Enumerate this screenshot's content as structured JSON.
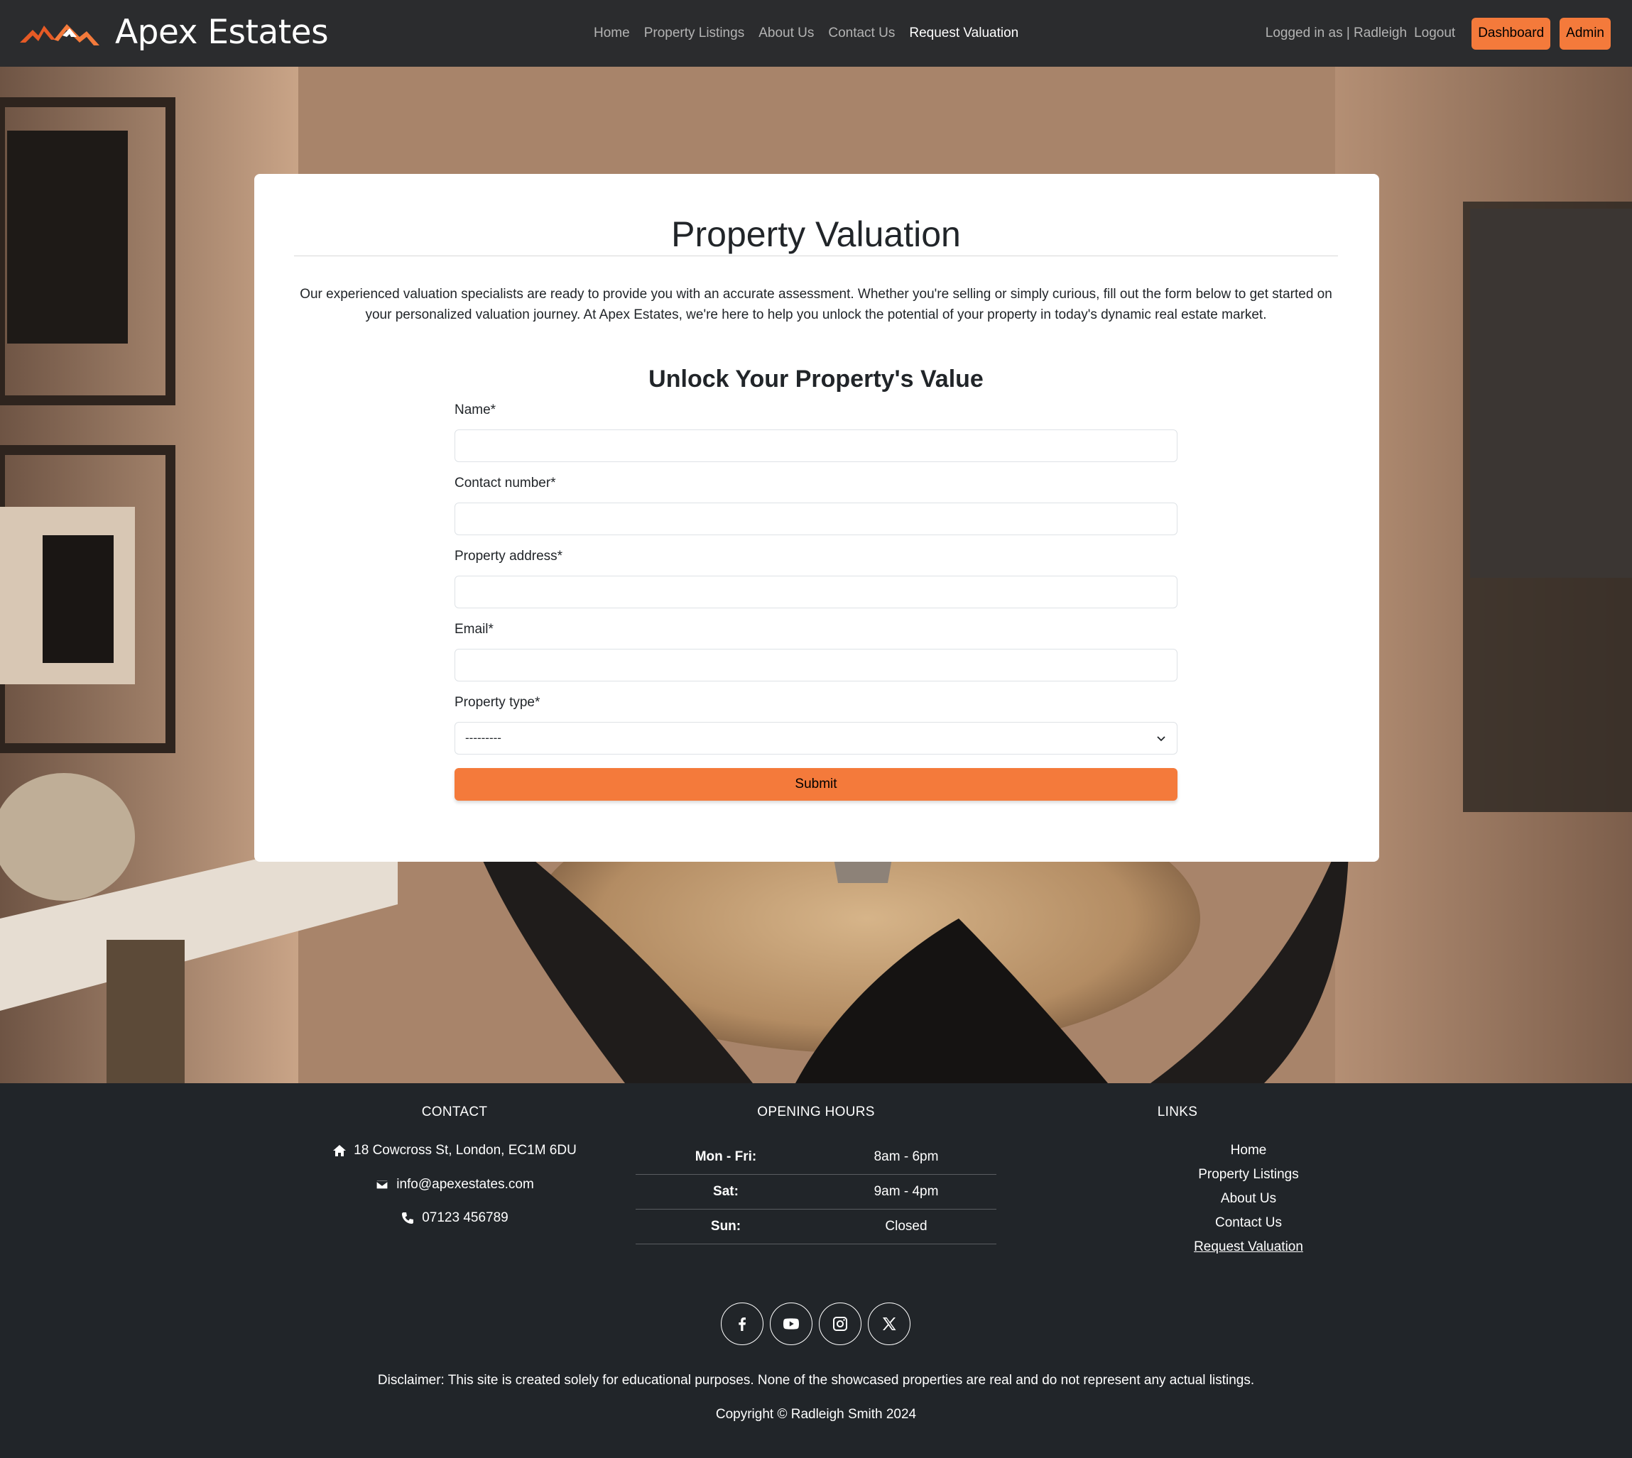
{
  "brand": {
    "name": "Apex Estates",
    "logo_icon": "mountain-logo"
  },
  "nav": {
    "links": [
      "Home",
      "Property Listings",
      "About Us",
      "Contact Us",
      "Request Valuation"
    ],
    "active": "Request Valuation",
    "logged_in_text": "Logged in as | Radleigh",
    "logout_label": "Logout",
    "dashboard_label": "Dashboard",
    "admin_label": "Admin"
  },
  "card": {
    "title": "Property Valuation",
    "intro": "Our experienced valuation specialists are ready to provide you with an accurate assessment. Whether you're selling or simply curious, fill out the form below to get started on your personalized valuation journey. At Apex Estates, we're here to help you unlock the potential of your property in today's dynamic real estate market.",
    "form_title": "Unlock Your Property's Value",
    "fields": {
      "name_label": "Name*",
      "name_value": "",
      "contact_label": "Contact number*",
      "contact_value": "",
      "address_label": "Property address*",
      "address_value": "",
      "email_label": "Email*",
      "email_value": "",
      "type_label": "Property type*",
      "type_value": "---------"
    },
    "submit_label": "Submit"
  },
  "footer": {
    "contact": {
      "title": "CONTACT",
      "address": "18 Cowcross St, London, EC1M 6DU",
      "email": "info@apexestates.com",
      "phone": "07123 456789"
    },
    "hours": {
      "title": "OPENING HOURS",
      "rows": [
        {
          "day": "Mon - Fri:",
          "time": "8am - 6pm"
        },
        {
          "day": "Sat:",
          "time": "9am - 4pm"
        },
        {
          "day": "Sun:",
          "time": "Closed"
        }
      ]
    },
    "links": {
      "title": "LINKS",
      "items": [
        "Home",
        "Property Listings",
        "About Us",
        "Contact Us",
        "Request Valuation"
      ]
    },
    "social": [
      "facebook-icon",
      "youtube-icon",
      "instagram-icon",
      "x-icon"
    ],
    "disclaimer": "Disclaimer: This site is created solely for educational purposes. None of the showcased properties are real and do not represent any actual listings.",
    "copyright": "Copyright © Radleigh Smith 2024"
  },
  "colors": {
    "accent": "#f47a3b",
    "navbar": "#2b2c2e",
    "footer": "#212529"
  }
}
